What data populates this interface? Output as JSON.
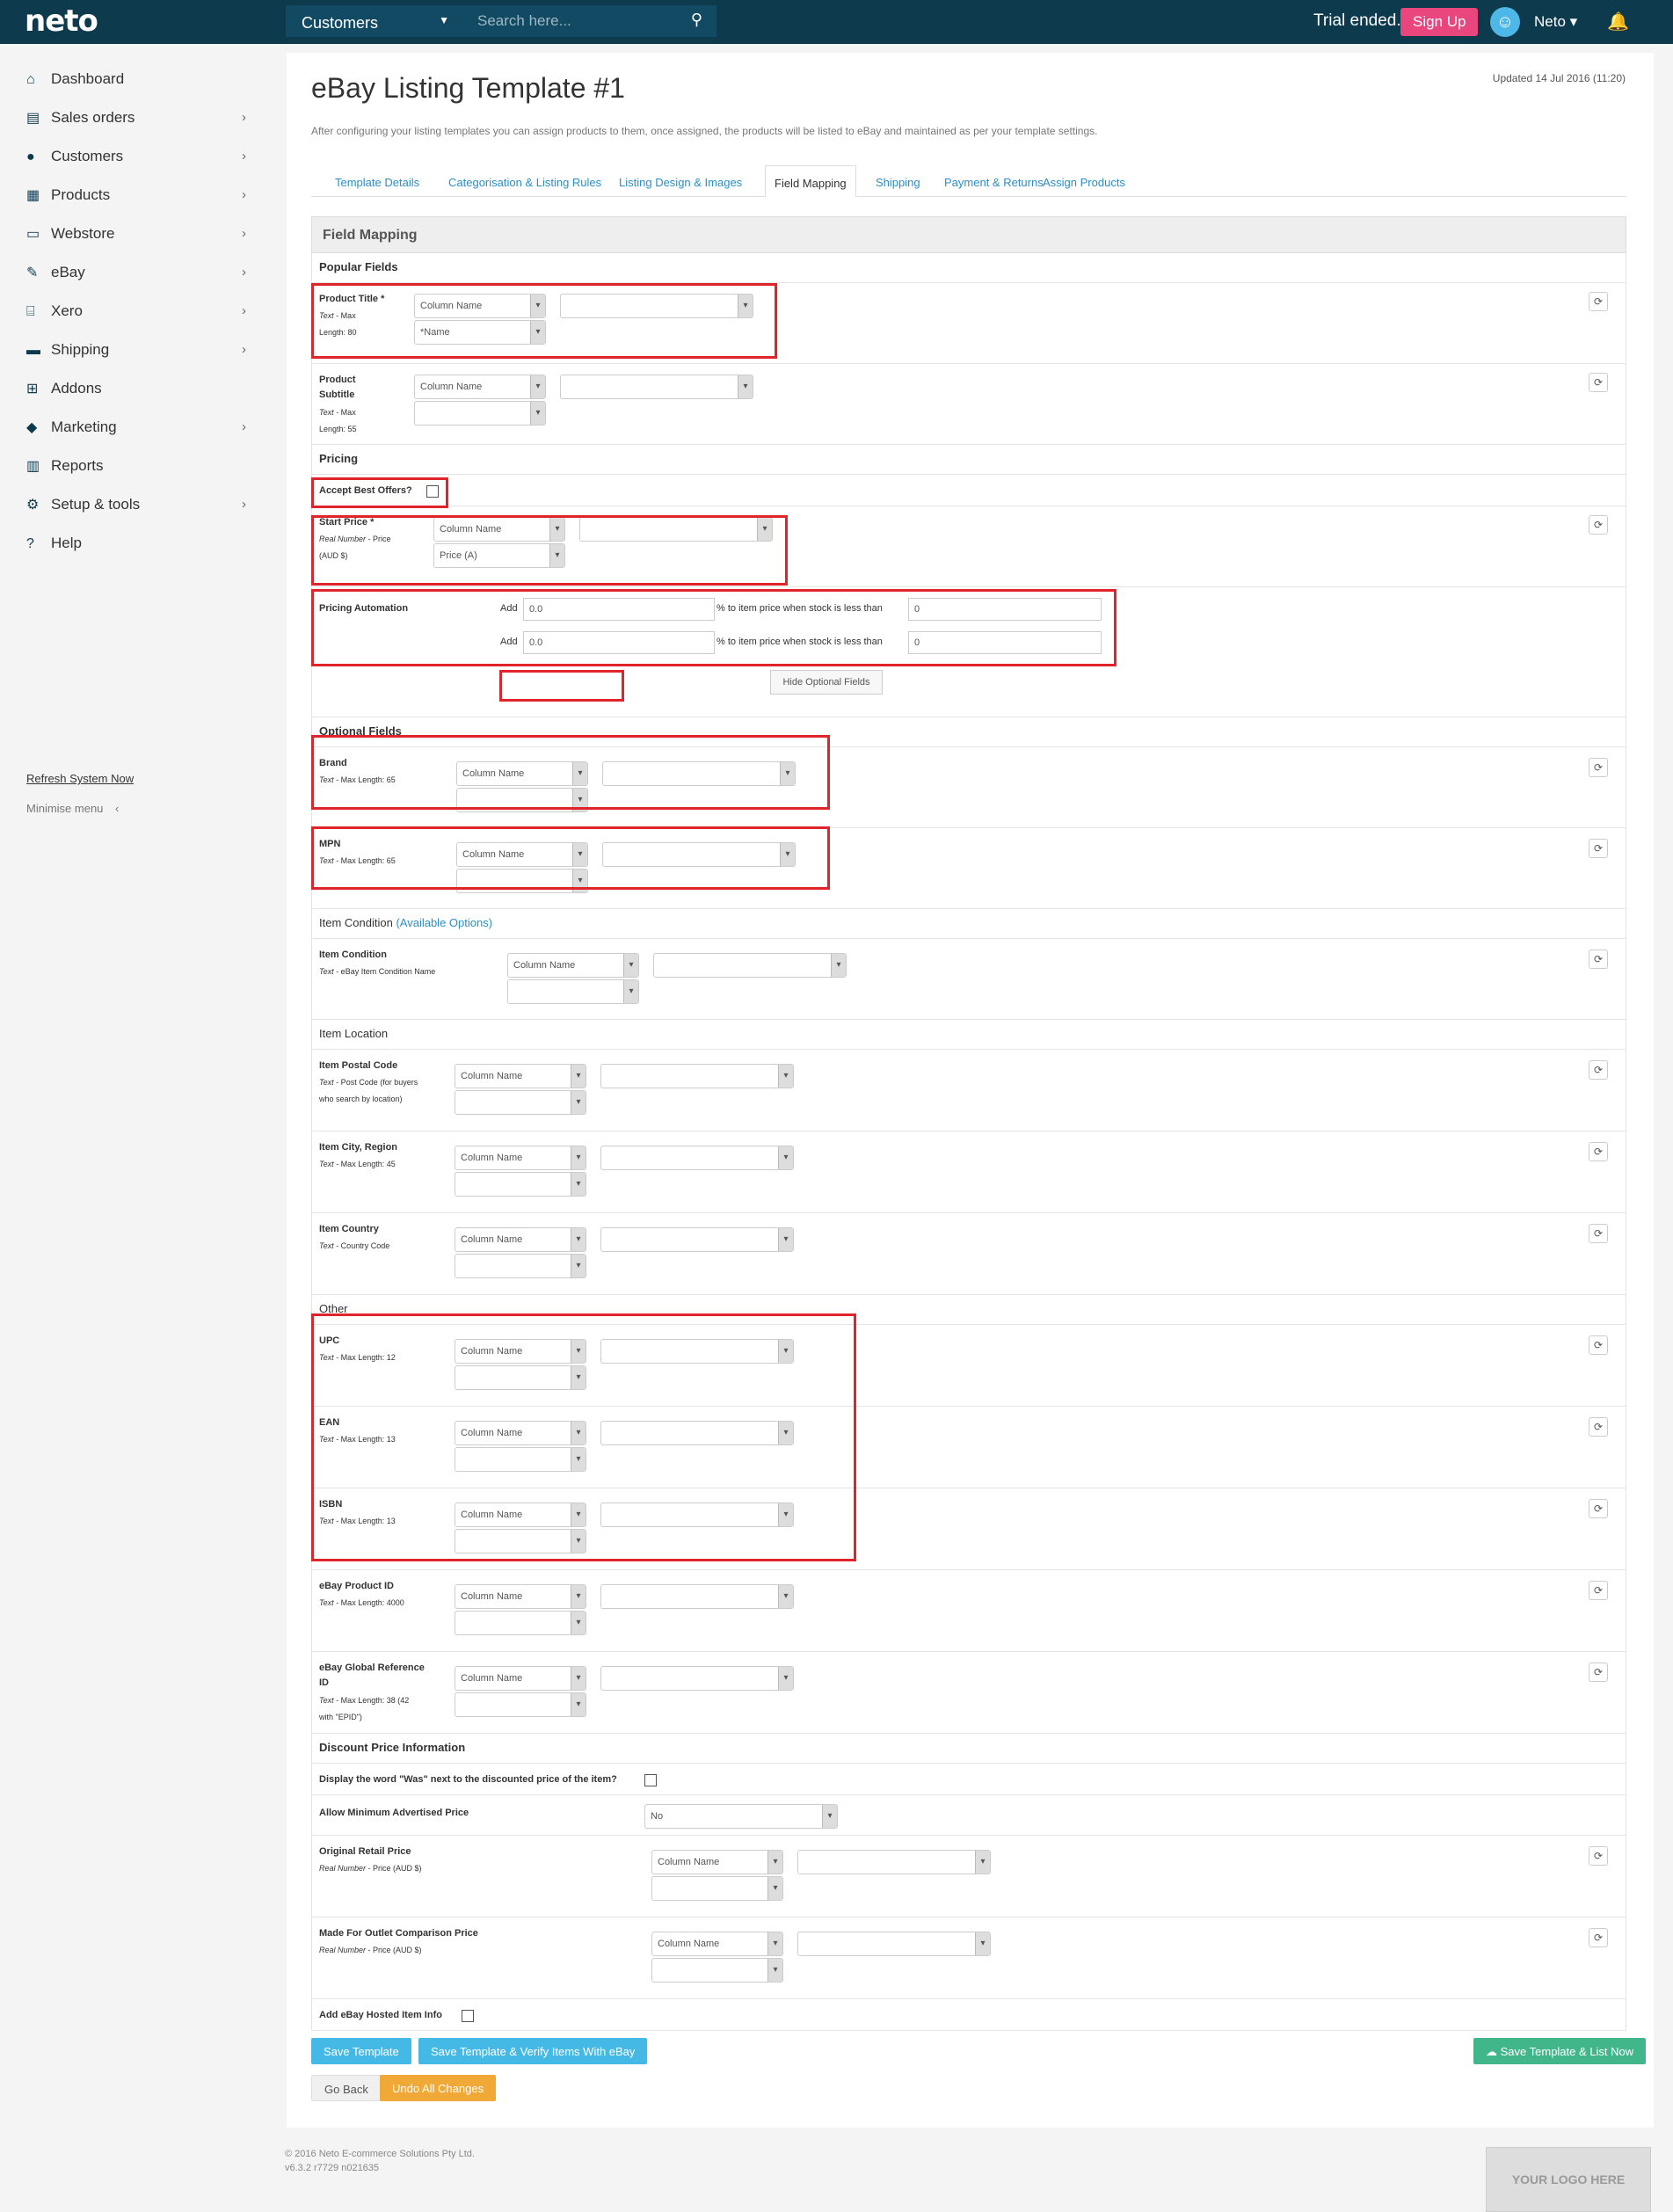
{
  "topbar": {
    "logo": "neto",
    "section_select": "Customers",
    "search_placeholder": "Search here...",
    "trial": "Trial ended.",
    "signup": "Sign Up",
    "user": "Neto ▾"
  },
  "sidebar": {
    "items": [
      {
        "label": "Dashboard",
        "icon": "home-icon"
      },
      {
        "label": "Sales orders",
        "icon": "file-icon"
      },
      {
        "label": "Customers",
        "icon": "user-icon"
      },
      {
        "label": "Products",
        "icon": "box-icon"
      },
      {
        "label": "Webstore",
        "icon": "window-icon"
      },
      {
        "label": "eBay",
        "icon": "gavel-icon"
      },
      {
        "label": "Xero",
        "icon": "bank-icon"
      },
      {
        "label": "Shipping",
        "icon": "truck-icon"
      },
      {
        "label": "Addons",
        "icon": "plus-icon"
      },
      {
        "label": "Marketing",
        "icon": "tag-icon"
      },
      {
        "label": "Reports",
        "icon": "chart-icon"
      },
      {
        "label": "Setup & tools",
        "icon": "gear-icon"
      },
      {
        "label": "Help",
        "icon": "question-icon"
      }
    ],
    "refresh": "Refresh System Now",
    "minimise": "Minimise menu"
  },
  "page": {
    "updated": "Updated 14 Jul 2016 (11:20)",
    "title": "eBay Listing Template #1",
    "intro": "After configuring your listing templates you can assign products to them, once assigned, the products will be listed to eBay and maintained as per your template settings."
  },
  "tabs": [
    "Template Details",
    "Categorisation & Listing Rules",
    "Listing Design & Images",
    "Field Mapping",
    "Shipping",
    "Payment & Returns",
    "Assign Products"
  ],
  "field_mapping": {
    "heading": "Field Mapping",
    "popular": "Popular Fields",
    "pricing": "Pricing",
    "optional": "Optional Fields",
    "item_condition": "Item Condition",
    "available_options": "(Available Options)",
    "item_location": "Item Location",
    "other": "Other",
    "discount": "Discount Price Information",
    "column_name": "Column Name",
    "accept_best_offers": "Accept Best Offers?",
    "pricing_automation": "Pricing Automation",
    "add": "Add",
    "pa_value": "0.0",
    "pa_text": "% to item price when stock is less than",
    "pa_stock": "0",
    "hide_optional": "Hide Optional Fields",
    "was_label": "Display the word \"Was\" next to the discounted price of the item?",
    "min_adv": "Allow Minimum Advertised Price",
    "min_adv_value": "No",
    "hosted": "Add eBay Hosted Item Info"
  },
  "fields": {
    "product_title": {
      "name": "Product Title *",
      "type": "Text",
      "desc": " - Max",
      "desc2": "Length: 80",
      "sub": "*Name"
    },
    "product_subtitle": {
      "name": "Product",
      "name2": "Subtitle",
      "type": "Text",
      "desc": " - Max",
      "desc2": "Length: 55"
    },
    "start_price": {
      "name": "Start Price *",
      "type": "Real Number",
      "desc": " - Price",
      "desc2": "(AUD $)",
      "sub": "Price (A)"
    },
    "brand": {
      "name": "Brand",
      "type": "Text",
      "desc": " - Max Length: 65"
    },
    "mpn": {
      "name": "MPN",
      "type": "Text",
      "desc": " - Max Length: 65"
    },
    "item_condition": {
      "name": "Item Condition",
      "type": "Text",
      "desc": " - eBay Item Condition Name"
    },
    "postal": {
      "name": "Item Postal Code",
      "type": "Text",
      "desc": " - Post Code (for buyers",
      "desc2": "who search by location)"
    },
    "city": {
      "name": "Item City, Region",
      "type": "Text",
      "desc": " - Max Length: 45"
    },
    "country": {
      "name": "Item Country",
      "type": "Text",
      "desc": " - Country Code"
    },
    "upc": {
      "name": "UPC",
      "type": "Text",
      "desc": " - Max Length: 12"
    },
    "ean": {
      "name": "EAN",
      "type": "Text",
      "desc": " - Max Length: 13"
    },
    "isbn": {
      "name": "ISBN",
      "type": "Text",
      "desc": " - Max Length: 13"
    },
    "ebay_product_id": {
      "name": "eBay Product ID",
      "type": "Text",
      "desc": " - Max Length: 4000"
    },
    "global_ref": {
      "name": "eBay Global Reference",
      "name2": "ID",
      "type": "Text",
      "desc": " - Max Length: 38 (42",
      "desc2": "with \"EPID\")"
    },
    "orig_retail": {
      "name": "Original Retail Price",
      "type": "Real Number",
      "desc": " - Price (AUD $)"
    },
    "outlet": {
      "name": "Made For Outlet Comparison Price",
      "type": "Real Number",
      "desc": " - Price (AUD $)"
    }
  },
  "buttons": {
    "save": "Save Template",
    "save_verify": "Save Template & Verify Items With eBay",
    "save_list": "Save Template & List Now",
    "back": "Go Back",
    "undo": "Undo All Changes"
  },
  "footer": {
    "copyright": "© 2016 Neto E-commerce Solutions Pty Ltd.",
    "version": "v6.3.2 r7729 n021635",
    "logo_placeholder": "YOUR LOGO HERE"
  },
  "colors": {
    "topbar": "#0e3a4e",
    "accent": "#2a8fc7",
    "highlight": "#e0242b",
    "signup": "#e8467c"
  }
}
